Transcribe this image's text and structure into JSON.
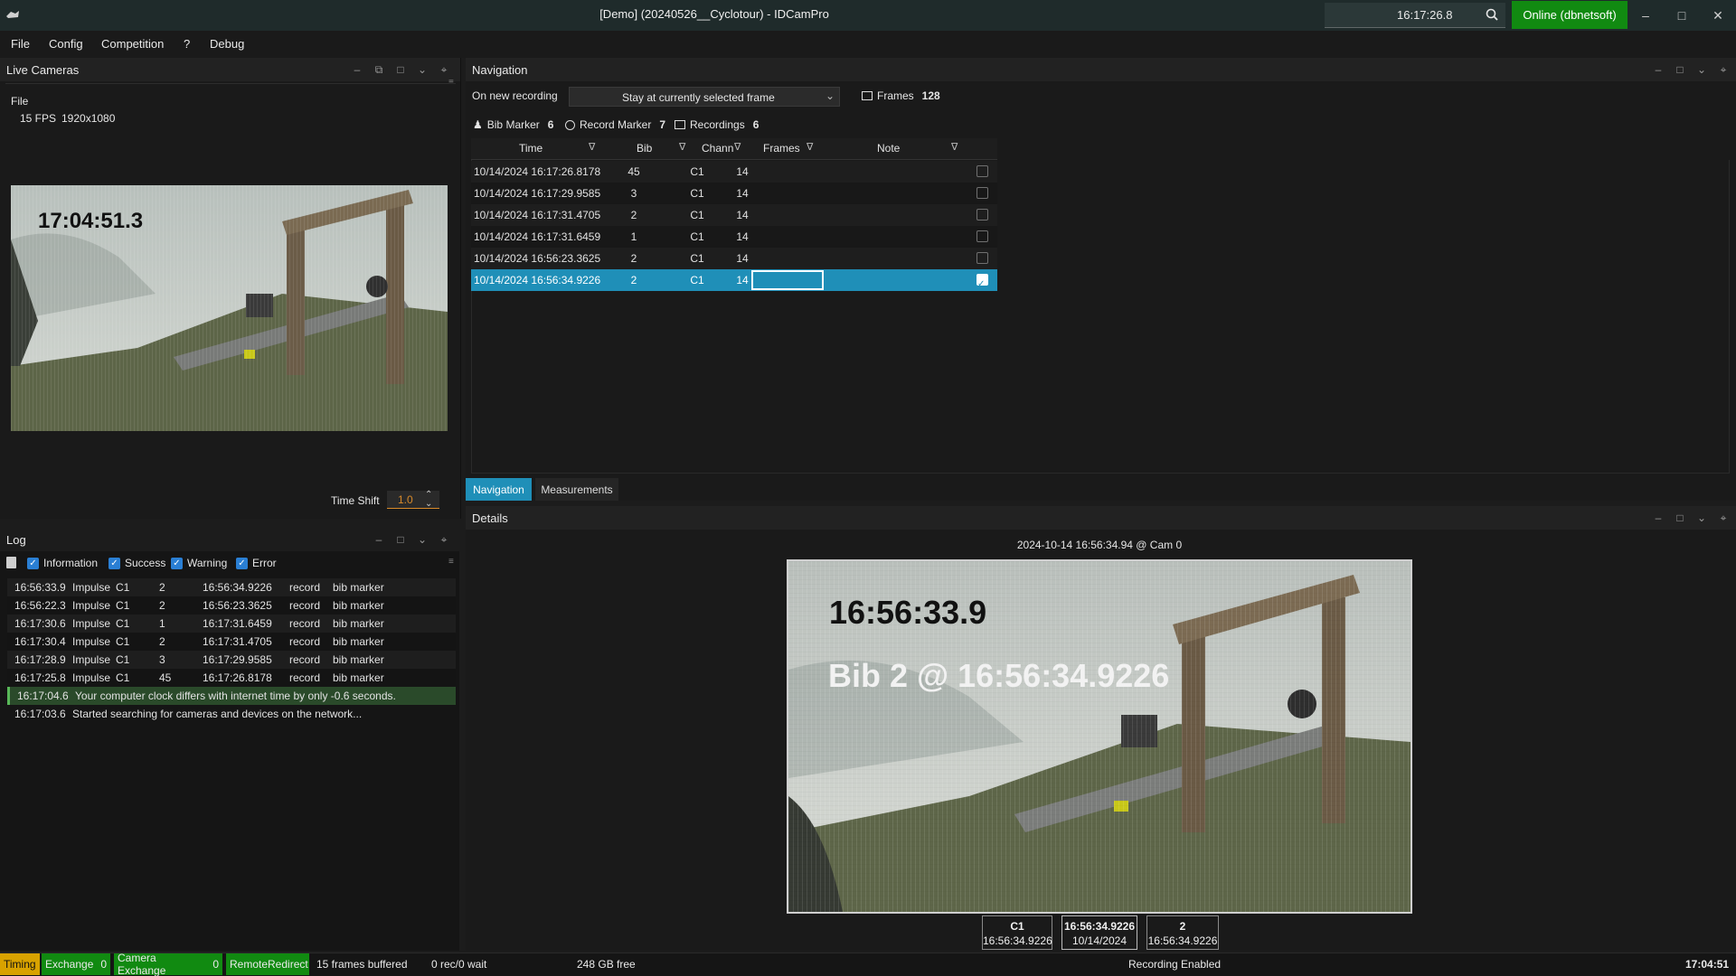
{
  "app": {
    "window_title": "[Demo] (20240526__Cyclotour) - IDCamPro",
    "search_time": "16:17:26.8",
    "online_label": "Online (dbnetsoft)"
  },
  "menu": [
    "File",
    "Config",
    "Competition",
    "?",
    "Debug"
  ],
  "live_cameras": {
    "title": "Live Cameras",
    "source": "File",
    "fps": "15 FPS",
    "resolution": "1920x1080",
    "overlay_time": "17:04:51.3",
    "time_shift_label": "Time Shift",
    "time_shift_value": "1.0"
  },
  "log": {
    "title": "Log",
    "filters": [
      "Information",
      "Success",
      "Warning",
      "Error"
    ],
    "rows": [
      {
        "time": "16:56:33.9",
        "type": "Impulse",
        "chan": "C1",
        "bib": "2",
        "ts": "16:56:34.9226",
        "action": "record",
        "what": "bib marker"
      },
      {
        "time": "16:56:22.3",
        "type": "Impulse",
        "chan": "C1",
        "bib": "2",
        "ts": "16:56:23.3625",
        "action": "record",
        "what": "bib marker"
      },
      {
        "time": "16:17:30.6",
        "type": "Impulse",
        "chan": "C1",
        "bib": "1",
        "ts": "16:17:31.6459",
        "action": "record",
        "what": "bib marker"
      },
      {
        "time": "16:17:30.4",
        "type": "Impulse",
        "chan": "C1",
        "bib": "2",
        "ts": "16:17:31.4705",
        "action": "record",
        "what": "bib marker"
      },
      {
        "time": "16:17:28.9",
        "type": "Impulse",
        "chan": "C1",
        "bib": "3",
        "ts": "16:17:29.9585",
        "action": "record",
        "what": "bib marker"
      },
      {
        "time": "16:17:25.8",
        "type": "Impulse",
        "chan": "C1",
        "bib": "45",
        "ts": "16:17:26.8178",
        "action": "record",
        "what": "bib marker"
      }
    ],
    "messages": [
      {
        "time": "16:17:04.6",
        "text": "Your computer clock differs with internet time by only -0.6 seconds."
      },
      {
        "time": "16:17:03.6",
        "text": "Started searching for cameras and devices on the network..."
      }
    ]
  },
  "navigation": {
    "title": "Navigation",
    "on_new_recording_label": "On new recording",
    "on_new_recording_value": "Stay at currently selected frame",
    "frames_label": "Frames",
    "frames_count": "128",
    "bib_marker_label": "Bib Marker",
    "bib_marker_count": "6",
    "record_marker_label": "Record Marker",
    "record_marker_count": "7",
    "recordings_label": "Recordings",
    "recordings_count": "6",
    "columns": [
      "Time",
      "Bib",
      "Chann",
      "Frames",
      "Note"
    ],
    "rows": [
      {
        "time": "10/14/2024 16:17:26.8178",
        "bib": "45",
        "chan": "C1",
        "frames": "14",
        "note": ""
      },
      {
        "time": "10/14/2024 16:17:29.9585",
        "bib": "3",
        "chan": "C1",
        "frames": "14",
        "note": ""
      },
      {
        "time": "10/14/2024 16:17:31.4705",
        "bib": "2",
        "chan": "C1",
        "frames": "14",
        "note": ""
      },
      {
        "time": "10/14/2024 16:17:31.6459",
        "bib": "1",
        "chan": "C1",
        "frames": "14",
        "note": ""
      },
      {
        "time": "10/14/2024 16:56:23.3625",
        "bib": "2",
        "chan": "C1",
        "frames": "14",
        "note": ""
      },
      {
        "time": "10/14/2024 16:56:34.9226",
        "bib": "2",
        "chan": "C1",
        "frames": "14",
        "note": ""
      }
    ],
    "tabs": [
      "Navigation",
      "Measurements"
    ]
  },
  "details": {
    "title": "Details",
    "caption": "2024-10-14 16:56:34.94 @ Cam 0",
    "overlay_time": "16:56:33.9",
    "overlay_bib": "Bib 2 @ 16:56:34.9226",
    "info_chan": "C1",
    "info_chan_time": "16:56:34.9226",
    "info_time": "16:56:34.9226",
    "info_date": "10/14/2024",
    "info_bib": "2",
    "info_bib_time": "16:56:34.9226"
  },
  "status": {
    "timing": "Timing",
    "exchange": "Exchange",
    "exchange_count": "0",
    "camera_exchange": "Camera Exchange",
    "camera_exchange_count": "0",
    "remote_redirect": "RemoteRedirect",
    "frames_buffered": "15 frames buffered",
    "rec_wait": "0 rec/0 wait",
    "disk_free": "248 GB free",
    "recording": "Recording Enabled",
    "clock": "17:04:51"
  },
  "colors": {
    "accent": "#1f8fb8",
    "online": "#118a11",
    "timing": "#d8a200",
    "log_highlight": "#2a4a2a"
  }
}
